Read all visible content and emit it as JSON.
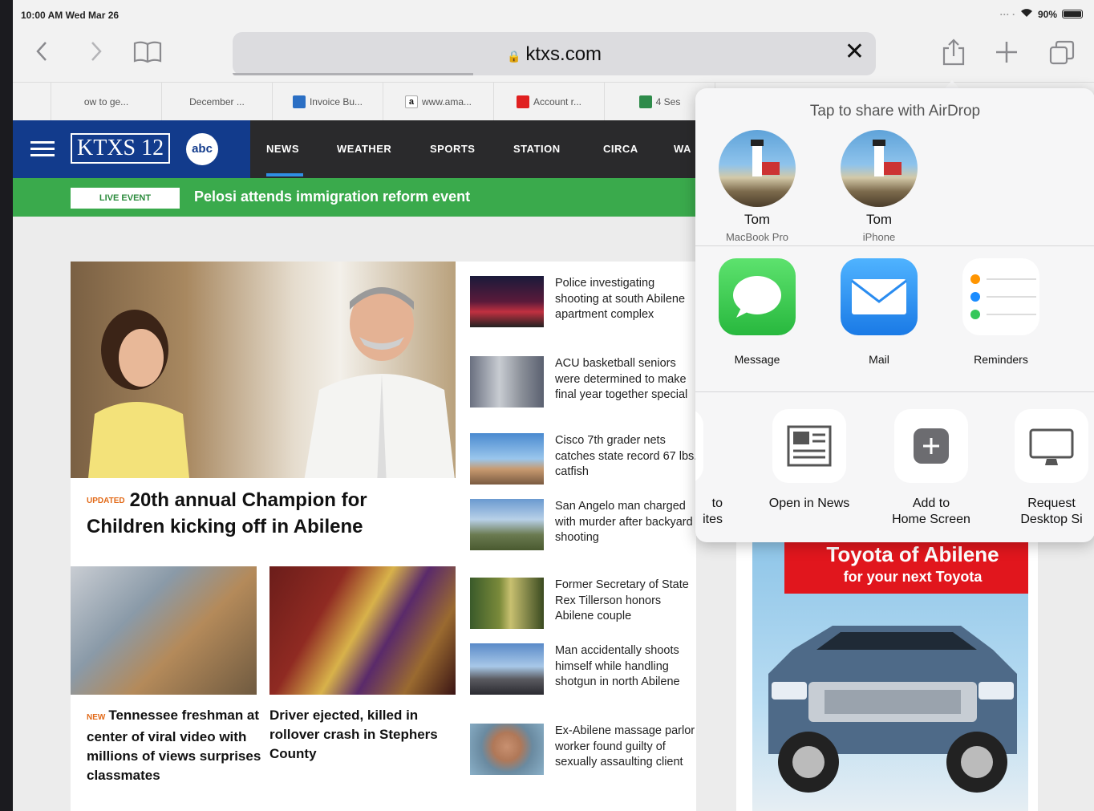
{
  "status": {
    "time": "10:00 AM  Wed Mar 26",
    "battery": "90%"
  },
  "toolbar": {
    "url": "ktxs.com"
  },
  "bookmarks": [
    "ow to ge...",
    "December ...",
    "Invoice Bu...",
    "www.ama...",
    "Account r...",
    "4 Ses"
  ],
  "site": {
    "logo": "KTXS 12",
    "network": "abc",
    "nav": [
      "NEWS",
      "WEATHER",
      "SPORTS",
      "STATION",
      "CIRCA",
      "WA"
    ],
    "live_badge": "LIVE EVENT",
    "live_text": "Pelosi attends immigration reform event",
    "hero": {
      "tag": "UPDATED",
      "title": "20th annual Champion for Children kicking off in Abilene"
    },
    "sub_stories": [
      {
        "tag": "NEW",
        "title": "Tennessee freshman at center of viral video with millions of views surprises classmates"
      },
      {
        "tag": "",
        "title": "Driver ejected, killed in rollover crash in Stephers County"
      }
    ],
    "list": [
      "Police investigating shooting at south Abilene apartment complex",
      "ACU basketball seniors were determined to make final year together special",
      "Cisco 7th grader nets catches state record 67 lbs. catfish",
      "San Angelo man charged with murder after backyard shooting",
      "Former Secretary of State Rex Tillerson honors Abilene couple",
      "Man accidentally shoots himself while handling shotgun in north Abilene",
      "Ex-Abilene massage parlor worker found guilty of sexually assaulting client"
    ],
    "ad": {
      "line1": "Toyota of Abilene",
      "line2": "for your next Toyota"
    }
  },
  "share": {
    "airdrop_title": "Tap to share with AirDrop",
    "people": [
      {
        "name": "Tom",
        "device": "MacBook Pro"
      },
      {
        "name": "Tom",
        "device": "iPhone"
      }
    ],
    "apps": [
      "Message",
      "Mail",
      "Reminders"
    ],
    "actions": [
      "to\nites",
      "Open in News",
      "Add to\nHome Screen",
      "Request\nDesktop Si"
    ]
  },
  "colors": {
    "brand": "#123b8c",
    "live": "#3aaa4c",
    "ad_red": "#e1161d",
    "messages": "#34c759",
    "mail": "#1e8cf0"
  }
}
